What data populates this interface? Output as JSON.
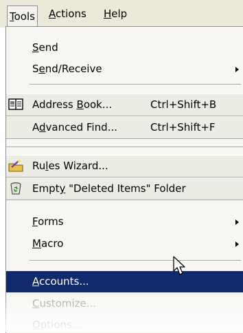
{
  "menubar": {
    "tools": {
      "label_u": "T",
      "label_rest": "ools"
    },
    "actions": {
      "label_u": "A",
      "label_rest": "ctions"
    },
    "help": {
      "label_u": "H",
      "label_rest": "elp"
    }
  },
  "menu": {
    "send": {
      "pre": "",
      "u": "S",
      "post": "end"
    },
    "send_receive": {
      "pre": "S",
      "u": "e",
      "post": "nd/Receive"
    },
    "address_book": {
      "pre": "Address ",
      "u": "B",
      "post": "ook...",
      "shortcut": "Ctrl+Shift+B",
      "icon": "address-book-icon"
    },
    "advanced_find": {
      "pre": "A",
      "u": "d",
      "post": "vanced Find...",
      "shortcut": "Ctrl+Shift+F"
    },
    "rules_wizard": {
      "pre": "Ru",
      "u": "l",
      "post": "es Wizard...",
      "icon": "rules-wizard-icon"
    },
    "empty_deleted": {
      "pre": "Empt",
      "u": "y",
      "post": " \"Deleted Items\" Folder",
      "icon": "recycle-bin-icon"
    },
    "forms": {
      "pre": "",
      "u": "F",
      "post": "orms"
    },
    "macro": {
      "pre": "",
      "u": "M",
      "post": "acro"
    },
    "accounts": {
      "pre": "",
      "u": "A",
      "post": "ccounts..."
    },
    "customize": {
      "pre": "",
      "u": "C",
      "post": "ustomize..."
    },
    "options": {
      "pre": "",
      "u": "O",
      "post": "ptions..."
    }
  },
  "colors": {
    "highlight": "#102a6b",
    "menu_bg": "#f7f6f2",
    "menubar_bg": "#ece9d8"
  }
}
